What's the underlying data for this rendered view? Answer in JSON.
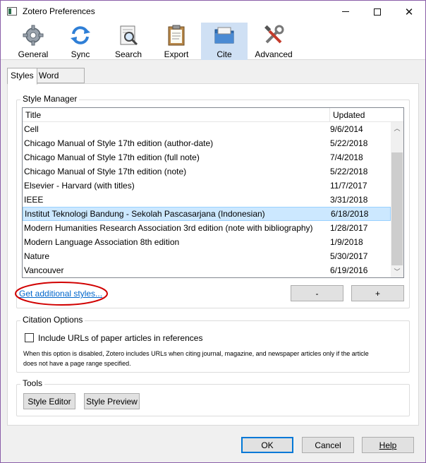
{
  "window": {
    "title": "Zotero Preferences"
  },
  "toolbar": {
    "items": [
      {
        "label": "General",
        "icon": "gear-icon"
      },
      {
        "label": "Sync",
        "icon": "sync-icon"
      },
      {
        "label": "Search",
        "icon": "search-icon"
      },
      {
        "label": "Export",
        "icon": "clipboard-icon"
      },
      {
        "label": "Cite",
        "icon": "folder-icon",
        "selected": true
      },
      {
        "label": "Advanced",
        "icon": "tools-icon"
      }
    ]
  },
  "tabs": [
    {
      "label": "Styles",
      "active": true
    },
    {
      "label": "Word Processors",
      "active": false
    }
  ],
  "style_manager": {
    "group_label": "Style Manager",
    "columns": {
      "title": "Title",
      "updated": "Updated"
    },
    "rows": [
      {
        "title": "Cell",
        "updated": "9/6/2014"
      },
      {
        "title": "Chicago Manual of Style 17th edition (author-date)",
        "updated": "5/22/2018"
      },
      {
        "title": "Chicago Manual of Style 17th edition (full note)",
        "updated": "7/4/2018"
      },
      {
        "title": "Chicago Manual of Style 17th edition (note)",
        "updated": "5/22/2018"
      },
      {
        "title": "Elsevier - Harvard (with titles)",
        "updated": "11/7/2017"
      },
      {
        "title": "IEEE",
        "updated": "3/31/2018"
      },
      {
        "title": "Institut Teknologi Bandung - Sekolah Pascasarjana (Indonesian)",
        "updated": "6/18/2018",
        "selected": true
      },
      {
        "title": "Modern Humanities Research Association 3rd edition (note with bibliography)",
        "updated": "1/28/2017"
      },
      {
        "title": "Modern Language Association 8th edition",
        "updated": "1/9/2018"
      },
      {
        "title": "Nature",
        "updated": "5/30/2017"
      },
      {
        "title": "Vancouver",
        "updated": "6/19/2016"
      }
    ],
    "get_more_link": "Get additional styles...",
    "remove_button": "-",
    "add_button": "+"
  },
  "citation_options": {
    "group_label": "Citation Options",
    "checkbox_label": "Include URLs of paper articles in references",
    "checked": false,
    "note_line1": "When this option is disabled, Zotero includes URLs when citing journal, magazine, and newspaper articles only if the article",
    "note_line2": "does not have a page range specified."
  },
  "tools": {
    "group_label": "Tools",
    "style_editor": "Style Editor",
    "style_preview": "Style Preview"
  },
  "footer": {
    "ok": "OK",
    "cancel": "Cancel",
    "help": "Help"
  },
  "colors": {
    "accent": "#0078d7",
    "selected_row": "#cce8ff",
    "annotation": "#d10000",
    "link": "#0066cc"
  }
}
